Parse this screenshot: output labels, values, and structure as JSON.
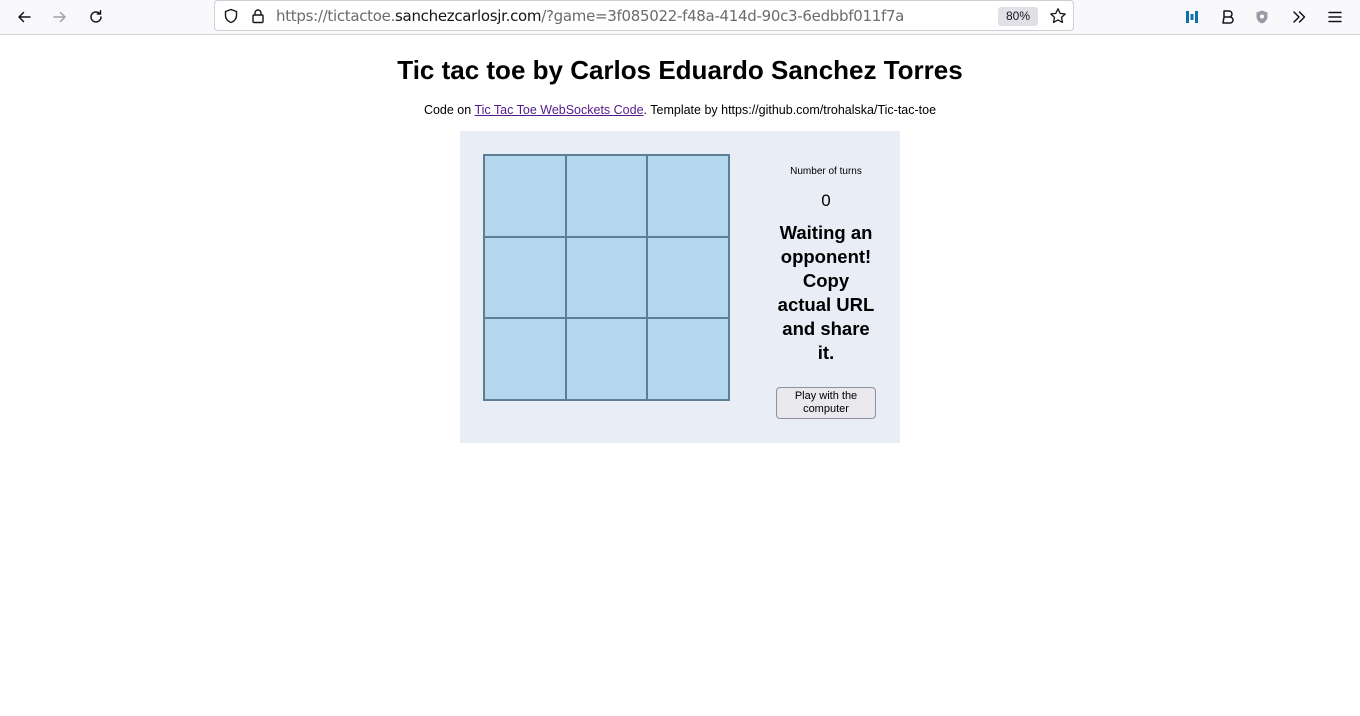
{
  "browser": {
    "url_prefix": "https://tictactoe.",
    "url_host": "sanchezcarlosjr.com",
    "url_path": "/?game=3f085022-f48a-414d-90c3-6edbbf011f7a",
    "zoom": "80%"
  },
  "page": {
    "title": "Tic tac toe by Carlos Eduardo Sanchez Torres",
    "credits_prefix": "Code on ",
    "credits_link": "Tic Tac Toe WebSockets Code",
    "credits_suffix": ". Template by https://github.com/trohalska/Tic-tac-toe"
  },
  "game": {
    "board": [
      [
        "",
        "",
        ""
      ],
      [
        "",
        "",
        ""
      ],
      [
        "",
        "",
        ""
      ]
    ],
    "turns_label": "Number of turns",
    "turns_count": "0",
    "status": "Waiting an opponent! Copy actual URL and share it.",
    "play_computer_label": "Play with the computer"
  },
  "colors": {
    "cell": "#b3d7ec",
    "cell_border": "#5d7e93",
    "panel": "#e9edf6",
    "link": "#551a8b"
  },
  "icons": {
    "back": "arrow-left-icon",
    "forward": "arrow-right-icon",
    "reload": "reload-icon",
    "tracking": "shield-icon",
    "lock": "lock-icon",
    "bookmark": "star-icon",
    "ext1": "extension-bars-icon",
    "ext2": "extension-b-icon",
    "ext3": "extension-shield-icon",
    "overflow": "chevron-double-right-icon",
    "menu": "hamburger-menu-icon"
  }
}
